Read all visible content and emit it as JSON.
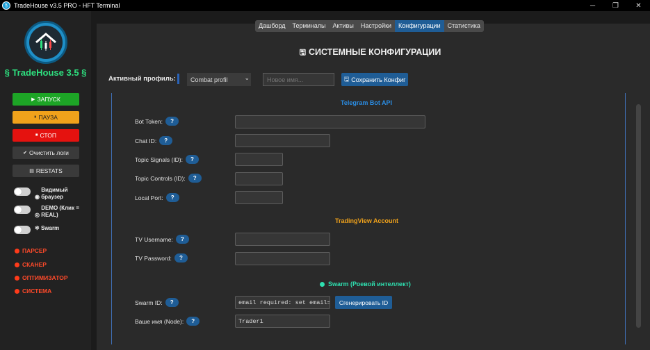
{
  "window": {
    "title": "TradeHouse v3.5 PRO - HFT Terminal",
    "app_icon": "tradehouse-icon",
    "minimize": "─",
    "restore": "❐",
    "close": "✕"
  },
  "sidebar": {
    "brand": "§ TradeHouse 3.5 §",
    "buttons": {
      "start": "ЗАПУСК",
      "pause": "ПАУЗА",
      "stop": "СТОП",
      "clear": "Очистить логи",
      "restats": "RESTATS"
    },
    "toggles": {
      "browser": "Видимый браузер",
      "demo": "DEMO (Клик = REAL)",
      "swarm": "Swarm"
    },
    "nav": [
      "ПАРСЕР",
      "СКАНЕР",
      "ОПТИМИЗАТОР",
      "СИСТЕМА"
    ],
    "colors": {
      "start": "#1da526",
      "pause": "#f0a21b",
      "stop": "#e5120f",
      "nav": "#ff4a2a"
    }
  },
  "tabs": [
    "Дашборд",
    "Терминалы",
    "Активы",
    "Настройки",
    "Конфигурации",
    "Статистика"
  ],
  "active_tab": "Конфигурации",
  "page_title": "СИСТЕМНЫЕ КОНФИГУРАЦИИ",
  "profile": {
    "label": "Активный профиль:",
    "selected": "Combat profil",
    "new_name_placeholder": "Новое имя...",
    "save_label": "Сохранить Конфиг"
  },
  "sections": {
    "telegram": {
      "title": "Telegram Bot API",
      "color": "#2a8be0",
      "fields": [
        {
          "label": "Bot Token:",
          "value": ""
        },
        {
          "label": "Chat ID:",
          "value": ""
        },
        {
          "label": "Topic Signals (ID):",
          "value": ""
        },
        {
          "label": "Topic Controls (ID):",
          "value": ""
        },
        {
          "label": "Local Port:",
          "value": ""
        }
      ]
    },
    "tradingview": {
      "title": "TradingView Account",
      "color": "#f0a21b",
      "fields": [
        {
          "label": "TV Username:",
          "value": ""
        },
        {
          "label": "TV Password:",
          "value": ""
        }
      ]
    },
    "swarm": {
      "title": "Swarm (Роевой интеллект)",
      "color": "#2ee0b0",
      "fields": [
        {
          "label": "Swarm ID:",
          "value": "email required: set email=с"
        },
        {
          "label": "Ваше имя (Node):",
          "value": "Trader1"
        }
      ],
      "generate_label": "Сгенерировать ID"
    }
  },
  "help_label": "?"
}
